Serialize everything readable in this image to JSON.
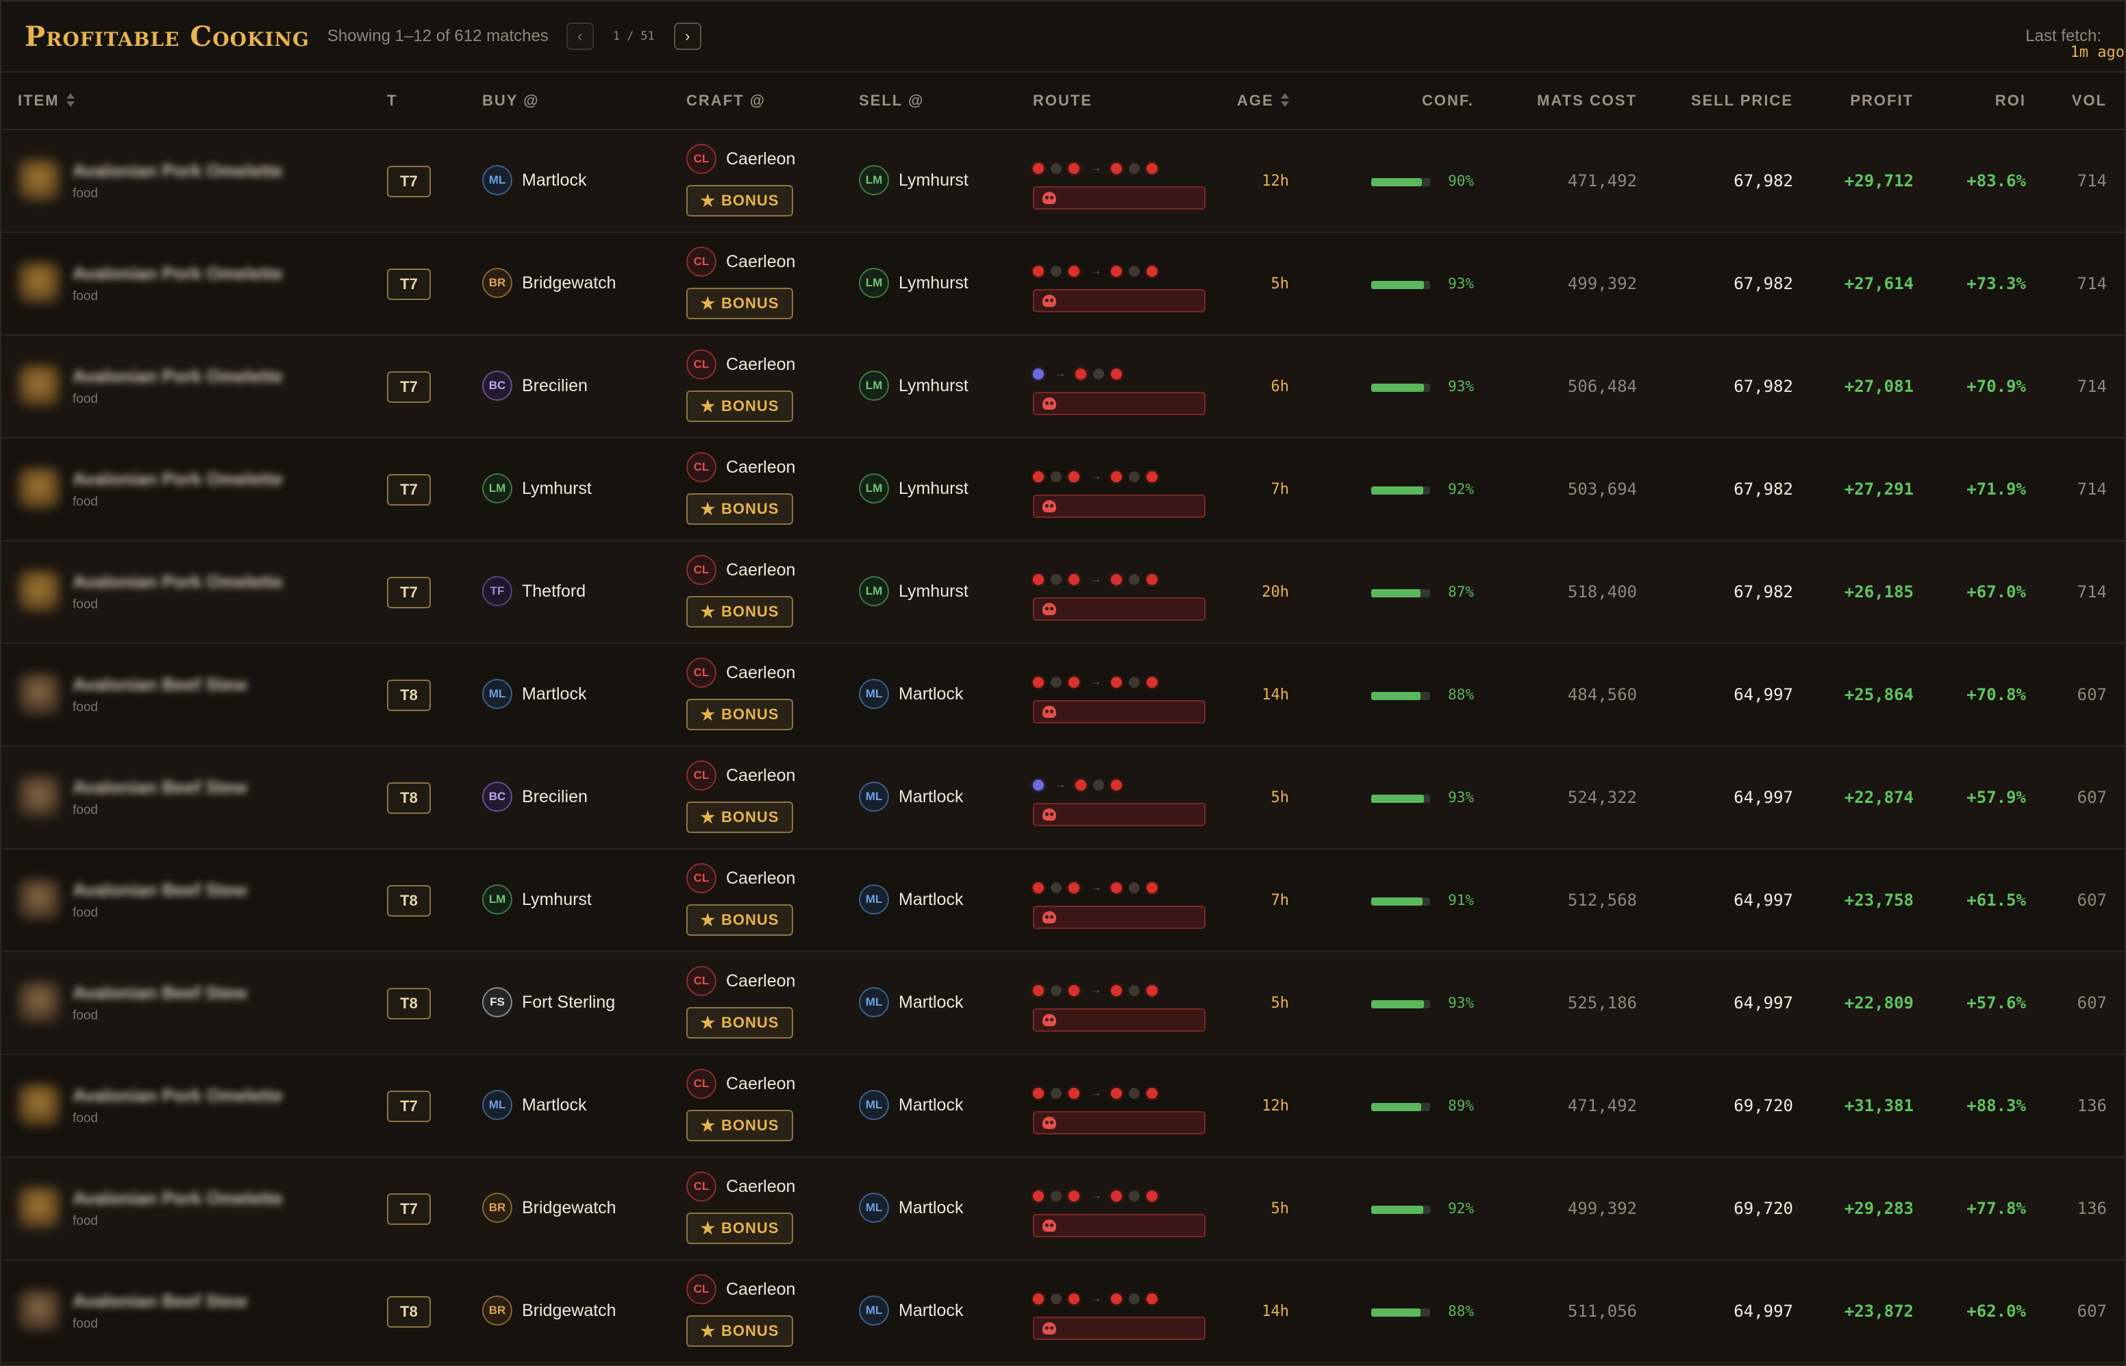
{
  "header": {
    "title": "Profitable Cooking",
    "showing": "Showing 1–12 of 612 matches",
    "page_current": "1",
    "page_sep": "/",
    "page_total": "51",
    "prev_icon": "chevron-left-icon",
    "next_icon": "chevron-right-icon",
    "last_fetch_label": "Last fetch:",
    "last_fetch_value": "1m ago"
  },
  "columns": {
    "item": "ITEM",
    "tier": "T",
    "buy": "BUY @",
    "craft": "CRAFT @",
    "sell": "SELL @",
    "route": "ROUTE",
    "age": "AGE",
    "conf": "CONF.",
    "mats": "MATS COST",
    "price": "SELL PRICE",
    "profit": "PROFIT",
    "roi": "ROI",
    "vol": "VOL"
  },
  "colors": {
    "accent": "#e6b34e",
    "profit": "#5fc45f",
    "danger": "#d8312e",
    "background": "#16120d"
  },
  "rows": [
    {
      "item_name": "Avalonian Pork Omelette",
      "category": "food",
      "tier": "T7",
      "buy_code": "ML",
      "buy_city": "Martlock",
      "craft_code": "CL",
      "craft_city": "Caerleon",
      "bonus": "BONUS",
      "sell_code": "LM",
      "sell_city": "Lymhurst",
      "route": "long",
      "age": "12h",
      "conf": 0.9,
      "conf_text": "90%",
      "mats": "471,492",
      "price": "67,982",
      "profit": "+29,712",
      "roi": "+83.6%",
      "vol": "714"
    },
    {
      "item_name": "Avalonian Pork Omelette",
      "category": "food",
      "tier": "T7",
      "buy_code": "BR",
      "buy_city": "Bridgewatch",
      "craft_code": "CL",
      "craft_city": "Caerleon",
      "bonus": "BONUS",
      "sell_code": "LM",
      "sell_city": "Lymhurst",
      "route": "long",
      "age": "5h",
      "conf": 0.93,
      "conf_text": "93%",
      "mats": "499,392",
      "price": "67,982",
      "profit": "+27,614",
      "roi": "+73.3%",
      "vol": "714"
    },
    {
      "item_name": "Avalonian Pork Omelette",
      "category": "food",
      "tier": "T7",
      "buy_code": "BC",
      "buy_city": "Brecilien",
      "craft_code": "CL",
      "craft_city": "Caerleon",
      "bonus": "BONUS",
      "sell_code": "LM",
      "sell_city": "Lymhurst",
      "route": "short",
      "age": "6h",
      "conf": 0.93,
      "conf_text": "93%",
      "mats": "506,484",
      "price": "67,982",
      "profit": "+27,081",
      "roi": "+70.9%",
      "vol": "714"
    },
    {
      "item_name": "Avalonian Pork Omelette",
      "category": "food",
      "tier": "T7",
      "buy_code": "LM",
      "buy_city": "Lymhurst",
      "craft_code": "CL",
      "craft_city": "Caerleon",
      "bonus": "BONUS",
      "sell_code": "LM",
      "sell_city": "Lymhurst",
      "route": "long",
      "age": "7h",
      "conf": 0.92,
      "conf_text": "92%",
      "mats": "503,694",
      "price": "67,982",
      "profit": "+27,291",
      "roi": "+71.9%",
      "vol": "714"
    },
    {
      "item_name": "Avalonian Pork Omelette",
      "category": "food",
      "tier": "T7",
      "buy_code": "TF",
      "buy_city": "Thetford",
      "craft_code": "CL",
      "craft_city": "Caerleon",
      "bonus": "BONUS",
      "sell_code": "LM",
      "sell_city": "Lymhurst",
      "route": "long",
      "age": "20h",
      "conf": 0.87,
      "conf_text": "87%",
      "mats": "518,400",
      "price": "67,982",
      "profit": "+26,185",
      "roi": "+67.0%",
      "vol": "714"
    },
    {
      "item_name": "Avalonian Beef Stew",
      "category": "food",
      "tier": "T8",
      "buy_code": "ML",
      "buy_city": "Martlock",
      "craft_code": "CL",
      "craft_city": "Caerleon",
      "bonus": "BONUS",
      "sell_code": "ML",
      "sell_city": "Martlock",
      "route": "long",
      "age": "14h",
      "conf": 0.88,
      "conf_text": "88%",
      "mats": "484,560",
      "price": "64,997",
      "profit": "+25,864",
      "roi": "+70.8%",
      "vol": "607"
    },
    {
      "item_name": "Avalonian Beef Stew",
      "category": "food",
      "tier": "T8",
      "buy_code": "BC",
      "buy_city": "Brecilien",
      "craft_code": "CL",
      "craft_city": "Caerleon",
      "bonus": "BONUS",
      "sell_code": "ML",
      "sell_city": "Martlock",
      "route": "short",
      "age": "5h",
      "conf": 0.93,
      "conf_text": "93%",
      "mats": "524,322",
      "price": "64,997",
      "profit": "+22,874",
      "roi": "+57.9%",
      "vol": "607"
    },
    {
      "item_name": "Avalonian Beef Stew",
      "category": "food",
      "tier": "T8",
      "buy_code": "LM",
      "buy_city": "Lymhurst",
      "craft_code": "CL",
      "craft_city": "Caerleon",
      "bonus": "BONUS",
      "sell_code": "ML",
      "sell_city": "Martlock",
      "route": "long",
      "age": "7h",
      "conf": 0.91,
      "conf_text": "91%",
      "mats": "512,568",
      "price": "64,997",
      "profit": "+23,758",
      "roi": "+61.5%",
      "vol": "607"
    },
    {
      "item_name": "Avalonian Beef Stew",
      "category": "food",
      "tier": "T8",
      "buy_code": "FS",
      "buy_city": "Fort Sterling",
      "craft_code": "CL",
      "craft_city": "Caerleon",
      "bonus": "BONUS",
      "sell_code": "ML",
      "sell_city": "Martlock",
      "route": "long",
      "age": "5h",
      "conf": 0.93,
      "conf_text": "93%",
      "mats": "525,186",
      "price": "64,997",
      "profit": "+22,809",
      "roi": "+57.6%",
      "vol": "607"
    },
    {
      "item_name": "Avalonian Pork Omelette",
      "category": "food",
      "tier": "T7",
      "buy_code": "ML",
      "buy_city": "Martlock",
      "craft_code": "CL",
      "craft_city": "Caerleon",
      "bonus": "BONUS",
      "sell_code": "ML",
      "sell_city": "Martlock",
      "route": "long",
      "age": "12h",
      "conf": 0.89,
      "conf_text": "89%",
      "mats": "471,492",
      "price": "69,720",
      "profit": "+31,381",
      "roi": "+88.3%",
      "vol": "136"
    },
    {
      "item_name": "Avalonian Pork Omelette",
      "category": "food",
      "tier": "T7",
      "buy_code": "BR",
      "buy_city": "Bridgewatch",
      "craft_code": "CL",
      "craft_city": "Caerleon",
      "bonus": "BONUS",
      "sell_code": "ML",
      "sell_city": "Martlock",
      "route": "long",
      "age": "5h",
      "conf": 0.92,
      "conf_text": "92%",
      "mats": "499,392",
      "price": "69,720",
      "profit": "+29,283",
      "roi": "+77.8%",
      "vol": "136"
    },
    {
      "item_name": "Avalonian Beef Stew",
      "category": "food",
      "tier": "T8",
      "buy_code": "BR",
      "buy_city": "Bridgewatch",
      "craft_code": "CL",
      "craft_city": "Caerleon",
      "bonus": "BONUS",
      "sell_code": "ML",
      "sell_city": "Martlock",
      "route": "long",
      "age": "14h",
      "conf": 0.88,
      "conf_text": "88%",
      "mats": "511,056",
      "price": "64,997",
      "profit": "+23,872",
      "roi": "+62.0%",
      "vol": "607"
    }
  ]
}
